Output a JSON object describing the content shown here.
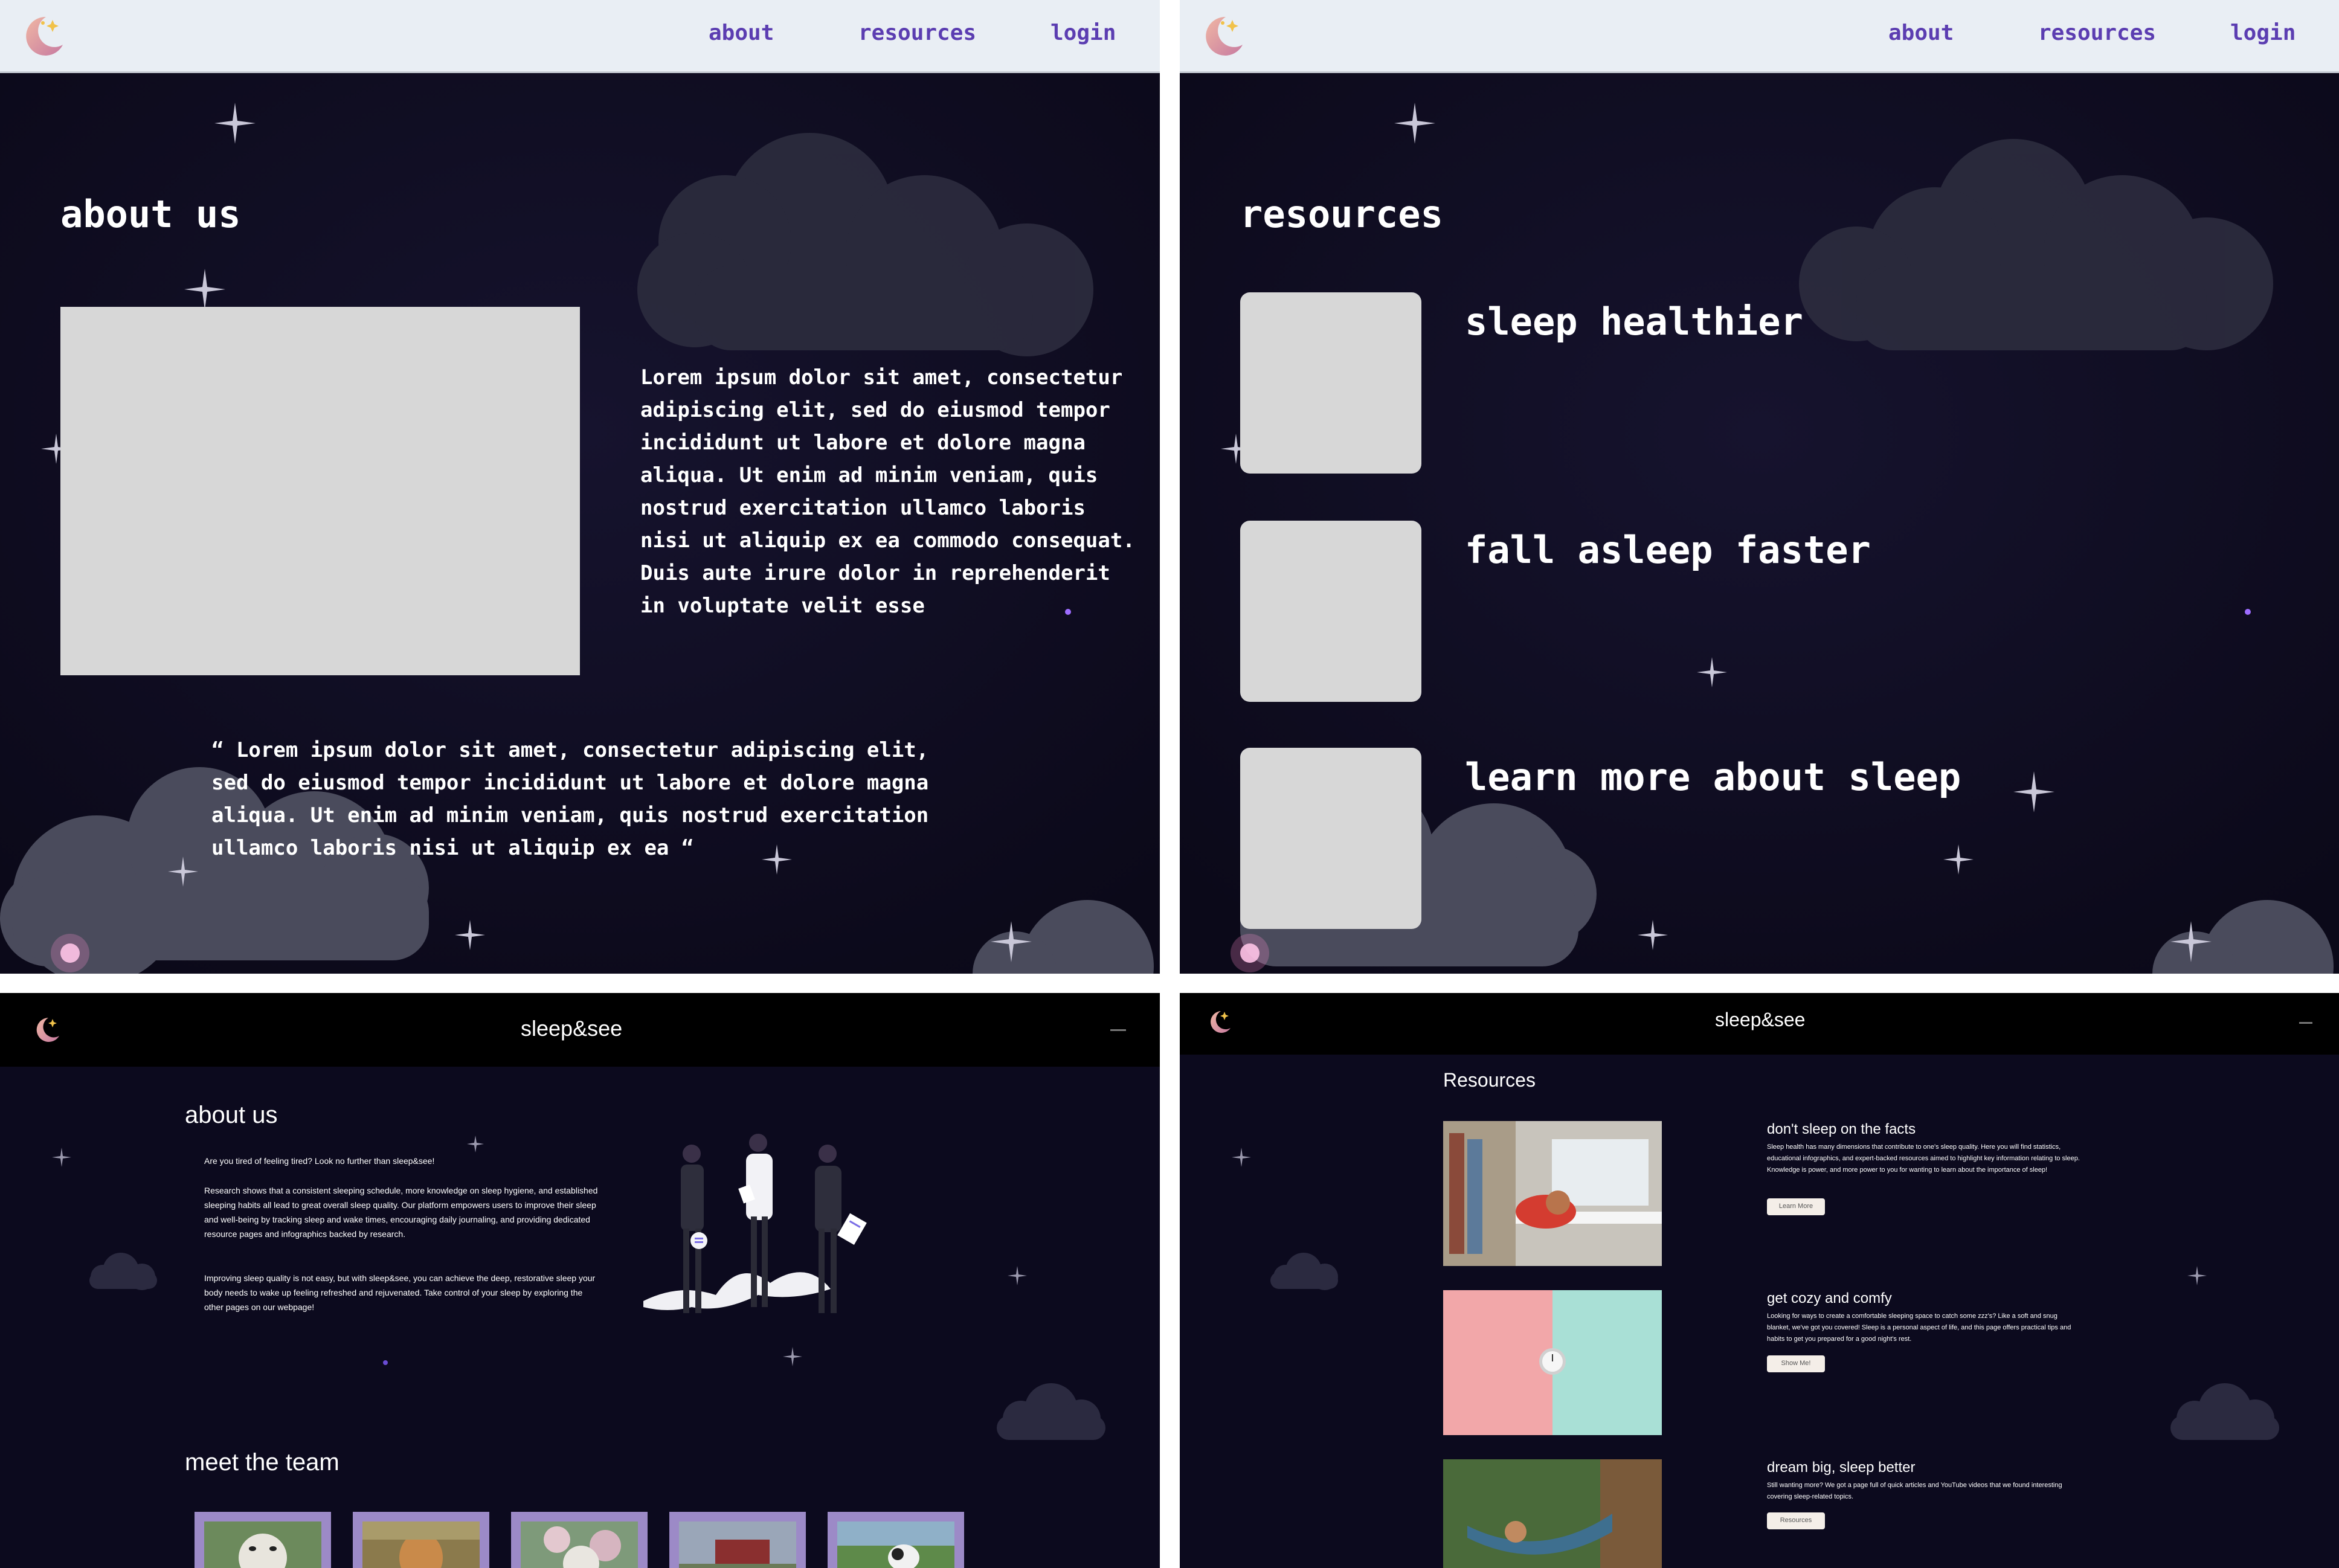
{
  "brand_colors": {
    "nav_link": "#5b3db1",
    "night_bg": "#0f0c22",
    "placeholder": "#d7d7d7",
    "card_frame": "#9c8ac7"
  },
  "panel_about": {
    "nav": {
      "links": [
        "about",
        "resources",
        "login"
      ]
    },
    "title": "about us",
    "body": "Lorem ipsum dolor sit amet, consectetur adipiscing elit, sed do eiusmod tempor incididunt ut labore et dolore magna aliqua. Ut enim ad minim veniam, quis nostrud exercitation ullamco laboris nisi ut aliquip ex ea commodo consequat. Duis aute irure dolor in reprehenderit in voluptate velit esse",
    "quote": "“ Lorem ipsum dolor sit amet, consectetur adipiscing elit, sed do eiusmod tempor incididunt ut labore et dolore magna aliqua. Ut enim ad minim veniam, quis nostrud exercitation ullamco laboris nisi ut aliquip ex ea “"
  },
  "panel_resources": {
    "nav": {
      "links": [
        "about",
        "resources",
        "login"
      ]
    },
    "title": "resources",
    "items": [
      "sleep healthier",
      "fall asleep faster",
      "learn more about sleep"
    ]
  },
  "panel_about_site": {
    "brand": "sleep&see",
    "title": "about us",
    "intro": "Are you tired of feeling tired? Look no further than sleep&see!",
    "para1": "Research shows that a consistent sleeping schedule, more knowledge on sleep hygiene, and established sleeping habits all lead to great overall sleep quality. Our platform empowers users to improve their sleep and well-being by tracking sleep and wake times, encouraging daily journaling, and providing dedicated resource pages and infographics backed by research.",
    "para2": "Improving sleep quality is not easy, but with sleep&see, you can achieve the deep, restorative sleep your body needs to wake up feeling refreshed and rejuvenated. Take control of your sleep by exploring the other pages on our webpage!",
    "team_title": "meet the team"
  },
  "panel_resources_site": {
    "brand": "sleep&see",
    "title": "Resources",
    "items": [
      {
        "heading": "don't sleep on the facts",
        "text": "Sleep health has many dimensions that contribute to one's sleep quality. Here you will find statistics, educational infographics, and expert-backed resources aimed to highlight key information relating to sleep. Knowledge is power, and more power to you for wanting to learn about the importance of sleep!",
        "button": "Learn More"
      },
      {
        "heading": "get cozy and comfy",
        "text": "Looking for ways to create a comfortable sleeping space to catch some zzz's? Like a soft and snug blanket, we've got you covered! Sleep is a personal aspect of life, and this page offers practical tips and habits to get you prepared for a good night's rest.",
        "button": "Show Me!"
      },
      {
        "heading": "dream big, sleep better",
        "text": "Still wanting more? We got a page full of quick articles and YouTube videos that we found interesting covering sleep-related topics.",
        "button": "Resources"
      }
    ]
  }
}
